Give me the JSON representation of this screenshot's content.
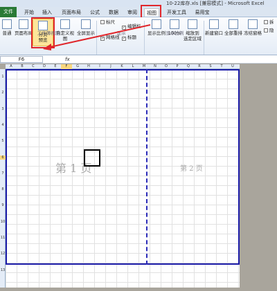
{
  "window": {
    "title": "10-22库存.xls [兼容模式] - Microsoft Excel"
  },
  "tabs": {
    "file": "文件",
    "items": [
      "开始",
      "插入",
      "页面布局",
      "公式",
      "数据",
      "审阅",
      "视图",
      "开发工具",
      "易用宝"
    ]
  },
  "ribbon": {
    "workbook_views": {
      "normal": "普通",
      "page_layout": "页面布局",
      "page_break_preview": "分页\n预览",
      "custom_views": "自定义视图",
      "full_screen": "全屏显示",
      "group_label": "工作簿视图"
    },
    "show": {
      "ruler": "标尺",
      "formula_bar": "编辑栏",
      "gridlines": "网格线",
      "headings": "标题",
      "group_label": "显示"
    },
    "zoom": {
      "zoom": "显示比例",
      "hundred": "100%",
      "zoom_to_selection": "缩放到\n选定区域",
      "group_label": "显示比例"
    },
    "window": {
      "new_window": "新建窗口",
      "arrange_all": "全部重排",
      "freeze_panes": "冻结窗格",
      "split": "拆",
      "hide": "隐"
    }
  },
  "formula_bar": {
    "name_box": "F6",
    "fx": "fx"
  },
  "columns": [
    "A",
    "B",
    "C",
    "D",
    "E",
    "F",
    "G",
    "H",
    "I",
    "J",
    "K",
    "L",
    "M",
    "N",
    "O",
    "P",
    "Q",
    "R",
    "S",
    "T",
    "U"
  ],
  "rows": [
    "1",
    "2",
    "3",
    "4",
    "5",
    "6",
    "7",
    "8",
    "9",
    "10",
    "11",
    "12",
    "13"
  ],
  "pages": {
    "page1": "第 1 页",
    "page2": "第 2 页"
  },
  "colors": {
    "accent_red": "#e0262b",
    "file_tab": "#2a7a36",
    "page_border": "#1c1ca8"
  }
}
